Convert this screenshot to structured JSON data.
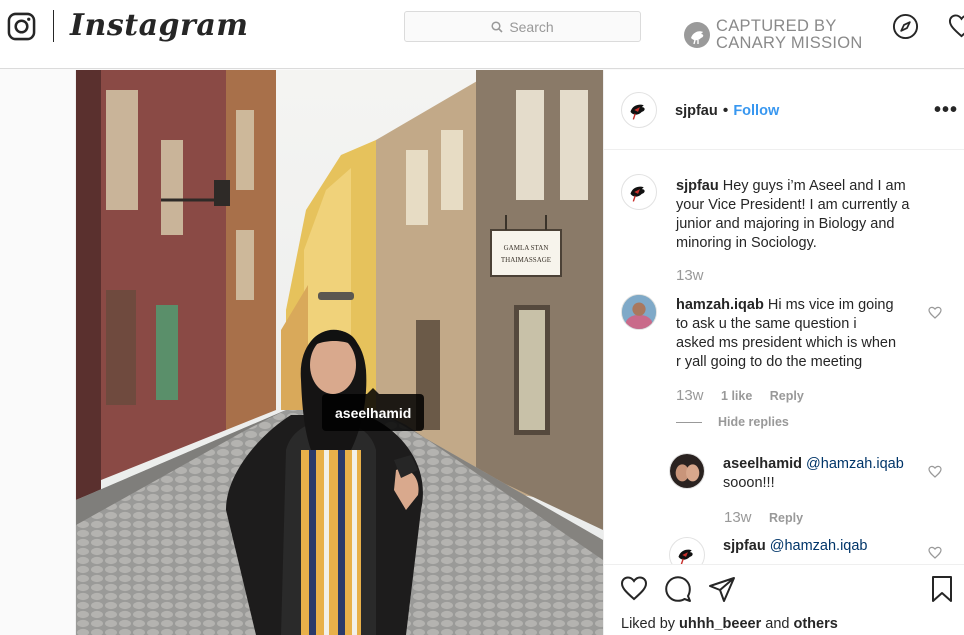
{
  "app": {
    "brand": "Instagram",
    "search_placeholder": "Search",
    "captured_line1": "CAPTURED BY",
    "captured_line2": "CANARY MISSION"
  },
  "photo": {
    "tag_label": "aseelhamid",
    "sign_line1": "GAMLA STAN",
    "sign_line2": "THAIMASSAGE"
  },
  "post": {
    "username": "sjpfau",
    "separator": "•",
    "follow_label": "Follow",
    "more_label": "•••"
  },
  "caption": {
    "username": "sjpfau",
    "lines": [
      "Hey guys i’m Aseel and I am",
      "your Vice President! I am currently a",
      "junior and majoring in Biology and",
      "minoring in Sociology."
    ],
    "time": "13w"
  },
  "comments": [
    {
      "username": "hamzah.iqab",
      "lines": [
        "Hi ms vice im going",
        "to ask u the same question i",
        "asked ms president which is when",
        "r yall going to do the meeting"
      ],
      "time": "13w",
      "likes": "1 like",
      "reply": "Reply"
    }
  ],
  "hide_replies": "Hide replies",
  "replies": [
    {
      "username": "aseelhamid",
      "mention": "@hamzah.iqab",
      "text": "sooon!!!",
      "time": "13w",
      "reply": "Reply"
    },
    {
      "username": "sjpfau",
      "mention": "@hamzah.iqab"
    }
  ],
  "footer": {
    "liked_by_prefix": "Liked by",
    "liked_by_user": "uhhh_beeer",
    "liked_by_and": "and",
    "liked_by_others": "others"
  },
  "colors": {
    "accent": "#3897f0",
    "mention": "#003569",
    "muted": "#999999",
    "border": "#dbdbdb"
  },
  "icons": [
    "instagram-glyph-icon",
    "search-icon",
    "canary-badge-icon",
    "compass-icon",
    "heart-icon",
    "comment-icon",
    "share-icon",
    "bookmark-icon",
    "more-options-icon"
  ]
}
